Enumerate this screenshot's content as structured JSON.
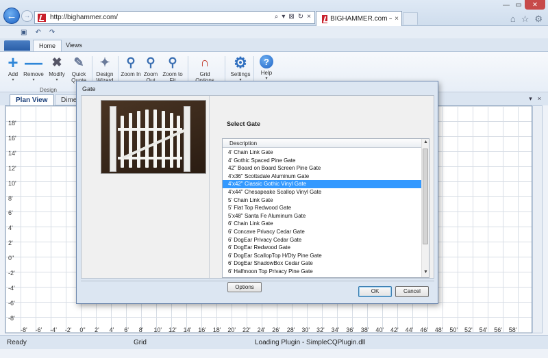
{
  "browser": {
    "url": "http://bighammer.com/",
    "tab_title": "BIGHAMMER.com – Big Ha...",
    "tab_close": "×",
    "address_actions": [
      "⌕",
      "▾",
      "⊠",
      "↻",
      "×"
    ],
    "window_controls": [
      "—",
      "▭",
      "✕"
    ],
    "right_icons": [
      "⌂",
      "☆",
      "⚙"
    ]
  },
  "ribbon": {
    "tabs": [
      "Home",
      "Views"
    ],
    "buttons": [
      {
        "label": "Add",
        "icon": "add-icon",
        "sub": "▾"
      },
      {
        "label": "Remove",
        "icon": "remove-icon",
        "sub": "▾"
      },
      {
        "label": "Modify",
        "icon": "tools-icon",
        "sub": "▾"
      },
      {
        "label": "Quick Quote",
        "icon": "quick-quote-icon",
        "sub": ""
      },
      {
        "label": "Design Wizard",
        "icon": "wand-icon",
        "sub": ""
      },
      {
        "label": "Zoom In",
        "icon": "zoom-in-icon",
        "sub": ""
      },
      {
        "label": "Zoom Out",
        "icon": "zoom-out-icon",
        "sub": ""
      },
      {
        "label": "Zoom to Fit",
        "icon": "zoom-fit-icon",
        "sub": ""
      },
      {
        "label": "Grid Options",
        "icon": "magnet-icon",
        "sub": ""
      },
      {
        "label": "Settings",
        "icon": "gear-icon",
        "sub": "▾"
      },
      {
        "label": "Help",
        "icon": "help-icon",
        "sub": "▾"
      }
    ],
    "group_label": "Design"
  },
  "doc_tabs": {
    "active": "Plan View",
    "inactive": "Dimen",
    "controls": [
      "▾",
      "×"
    ]
  },
  "grid": {
    "y_labels": [
      "18'",
      "16'",
      "14'",
      "12'",
      "10'",
      "8'",
      "6'",
      "4'",
      "2'",
      "0\"",
      "-2'",
      "-4'",
      "-6'",
      "-8'"
    ],
    "x_labels": [
      "-8'",
      "-6'",
      "-4'",
      "-2'",
      "0\"",
      "2'",
      "4'",
      "6'",
      "8'",
      "10'",
      "12'",
      "14'",
      "16'",
      "18'",
      "20'",
      "22'",
      "24'",
      "26'",
      "28'",
      "30'",
      "32'",
      "34'",
      "36'",
      "38'",
      "40'",
      "42'",
      "44'",
      "46'",
      "48'",
      "50'",
      "52'",
      "54'",
      "56'",
      "58'"
    ]
  },
  "status": {
    "ready": "Ready",
    "grid": "Grid",
    "message": "Loading Plugin - SimpleCQPlugin.dll"
  },
  "dialog": {
    "title": "Gate",
    "select_title": "Select Gate",
    "column_header": "Description",
    "selected_index": 4,
    "items": [
      "4' Chain Link Gate",
      "4' Gothic Spaced Pine Gate",
      "42\" Board on Board Screen Pine Gate",
      "4'x36\" Scottsdale Aluminum Gate",
      "4'x42\" Classic Gothic Vinyl Gate",
      "4'x44\" Chesapeake Scallop Vinyl Gate",
      "5' Chain Link Gate",
      "5' Flat Top Redwood Gate",
      "5'x48\" Santa Fe Aluminum Gate",
      "6' Chain Link Gate",
      "6' Concave Privacy Cedar Gate",
      "6' DogEar Privacy Cedar Gate",
      "6' DogEar Redwood Gate",
      "6' DogEar ScallopTop H/Dty Pine Gate",
      "6' DogEar ShadowBox Cedar Gate",
      "6' Halfmoon Top Privacy Pine Gate"
    ],
    "options_label": "Options",
    "ok_label": "OK",
    "cancel_label": "Cancel",
    "scroll_up": "▲",
    "scroll_down": "▼"
  }
}
